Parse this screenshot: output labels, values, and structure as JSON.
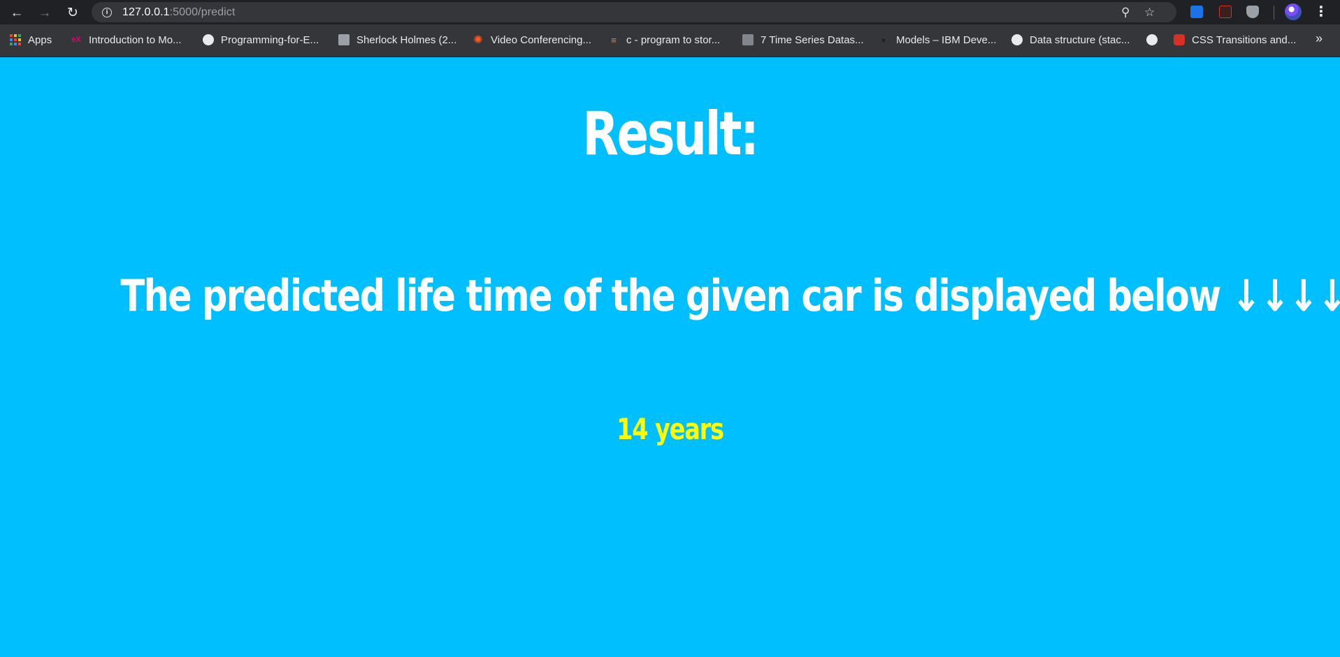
{
  "browser": {
    "url_host": "127.0.0.1",
    "url_path": ":5000/predict",
    "nav_icons": [
      "back-arrow-icon",
      "forward-arrow-icon",
      "reload-icon"
    ],
    "toolbar_icons": [
      "zoom-icon",
      "star-icon",
      "menu-dots-icon"
    ]
  },
  "bookmarks": {
    "items": [
      {
        "label": "Apps",
        "icon": "apps-grid-icon"
      },
      {
        "label": "Introduction to Mo...",
        "icon": "edx-icon"
      },
      {
        "label": "Programming-for-E...",
        "icon": "github-icon"
      },
      {
        "label": "Sherlock Holmes (2...",
        "icon": "clapperboard-icon"
      },
      {
        "label": "Video Conferencing...",
        "icon": "zoom-sun-icon"
      },
      {
        "label": "c - program to stor...",
        "icon": "stackoverflow-icon"
      },
      {
        "label": "7 Time Series Datas...",
        "icon": "dataset-icon"
      },
      {
        "label": "Models – IBM Deve...",
        "icon": "ibm-bee-icon"
      },
      {
        "label": "Data structure (stac...",
        "icon": "globe-icon"
      },
      {
        "label": "",
        "icon": "globe-icon"
      },
      {
        "label": "CSS Transitions and...",
        "icon": "css-tricks-icon"
      }
    ],
    "overflow": "»"
  },
  "page": {
    "title": "Result:",
    "subtitle": "The predicted life time of the given car is displayed below ↓↓↓↓",
    "prediction": "14 years"
  },
  "colors": {
    "background": "#00bfff",
    "heading": "#ffffff",
    "prediction": "#ffff00"
  }
}
